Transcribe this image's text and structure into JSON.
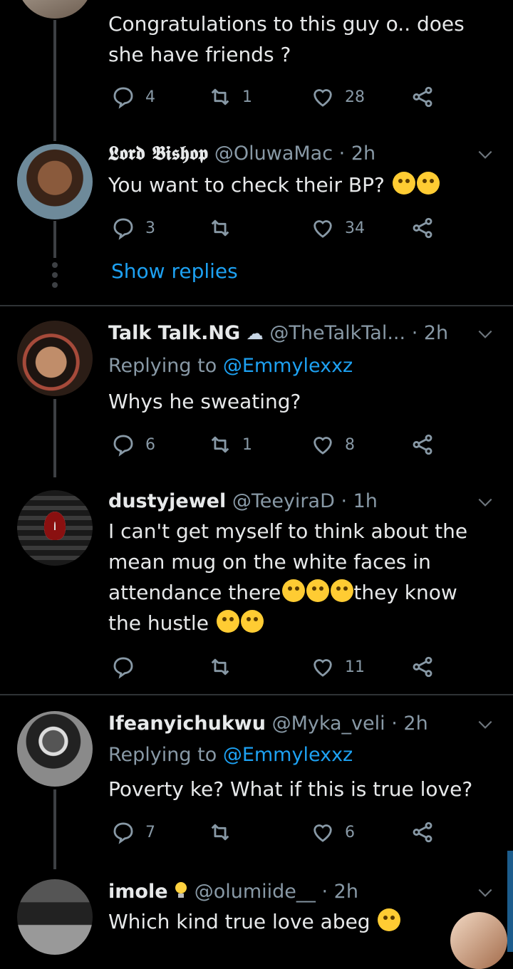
{
  "tweets": [
    {
      "id": "congrats",
      "text": "Congratulations to this guy o.. does she have friends ?",
      "reply_count": "4",
      "retweet_count": "1",
      "like_count": "28"
    },
    {
      "id": "lord",
      "name": "𝕷𝖔𝖗𝖉 𝕭𝖎𝖘𝖍𝖔𝖕",
      "handle": "@OluwaMac",
      "time": "· 2h",
      "text": "You want to check their BP?",
      "reply_count": "3",
      "retweet_count": "",
      "like_count": "34",
      "show_replies": "Show replies"
    },
    {
      "id": "talktalk",
      "name": "Talk Talk.NG",
      "handle": "@TheTalkTal...",
      "time": "· 2h",
      "replying_prefix": "Replying to ",
      "replying_mention": "@Emmylexxz",
      "text": "Whys he sweating?",
      "reply_count": "6",
      "retweet_count": "1",
      "like_count": "8"
    },
    {
      "id": "dusty",
      "name": "dustyjewel",
      "handle": "@TeeyiraD",
      "time": "· 1h",
      "text_part1": "I can't get myself to think about the mean mug on the white faces in attendance there",
      "text_part2": "they know the hustle",
      "reply_count": "",
      "retweet_count": "",
      "like_count": "11"
    },
    {
      "id": "ifeanyi",
      "name": "Ifeanyichukwu",
      "handle": "@Myka_veli",
      "time": "· 2h",
      "replying_prefix": "Replying to ",
      "replying_mention": "@Emmylexxz",
      "text": "Poverty ke? What if this is true love?",
      "reply_count": "7",
      "retweet_count": "",
      "like_count": "6"
    },
    {
      "id": "imole",
      "name": "imole",
      "handle": "@olumiide__",
      "time": "· 2h",
      "text": "Which kind true love abeg"
    }
  ],
  "colors": {
    "background": "#000000",
    "link": "#1da1f2",
    "muted": "#8899a6",
    "divider": "#2f3336"
  },
  "icons": [
    "reply-icon",
    "retweet-icon",
    "like-icon",
    "share-icon",
    "chevron-down-icon"
  ]
}
